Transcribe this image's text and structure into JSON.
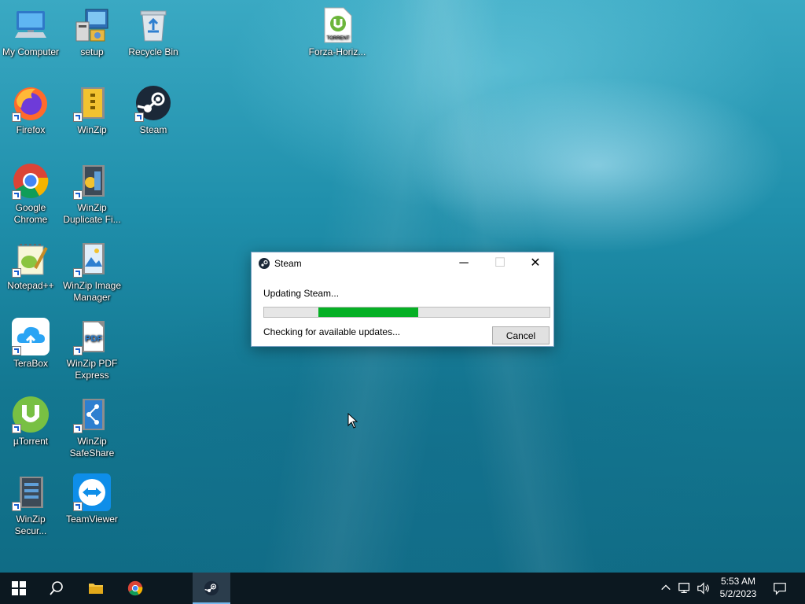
{
  "desktop": {
    "icons": [
      {
        "label": "My Computer",
        "icon": "computer-icon"
      },
      {
        "label": "setup",
        "icon": "setup-icon"
      },
      {
        "label": "Recycle Bin",
        "icon": "recycle-bin-icon"
      },
      {
        "label": "Forza-Horiz...",
        "icon": "torrent-file-icon"
      },
      {
        "label": "Firefox",
        "icon": "firefox-icon"
      },
      {
        "label": "WinZip",
        "icon": "winzip-icon"
      },
      {
        "label": "Steam",
        "icon": "steam-icon"
      },
      {
        "label": "Google Chrome",
        "icon": "chrome-icon"
      },
      {
        "label": "WinZip Duplicate Fi...",
        "icon": "winzip-duplicate-icon"
      },
      {
        "label": "Notepad++",
        "icon": "notepadpp-icon"
      },
      {
        "label": "WinZip Image Manager",
        "icon": "winzip-image-icon"
      },
      {
        "label": "TeraBox",
        "icon": "terabox-icon"
      },
      {
        "label": "WinZip PDF Express",
        "icon": "winzip-pdf-icon"
      },
      {
        "label": "µTorrent",
        "icon": "utorrent-icon"
      },
      {
        "label": "WinZip SafeShare",
        "icon": "winzip-safeshare-icon"
      },
      {
        "label": "WinZip Secur...",
        "icon": "winzip-secure-icon"
      },
      {
        "label": "TeamViewer",
        "icon": "teamviewer-icon"
      }
    ],
    "torrent_badge": "TORRENT",
    "pdf_badge": "PDF"
  },
  "dialog": {
    "title": "Steam",
    "message": "Updating Steam...",
    "progress_fraction": 0.35,
    "progress_offset_fraction": 0.19,
    "status": "Checking for available updates...",
    "cancel_label": "Cancel",
    "minimize_glyph": "─",
    "maximize_glyph": "☐",
    "close_glyph": "✕"
  },
  "taskbar": {
    "time": "5:53 AM",
    "date": "5/2/2023"
  },
  "colors": {
    "progress_fill": "#06b025",
    "taskbar_bg": "#0c1820",
    "accent": "#76b9ed"
  }
}
